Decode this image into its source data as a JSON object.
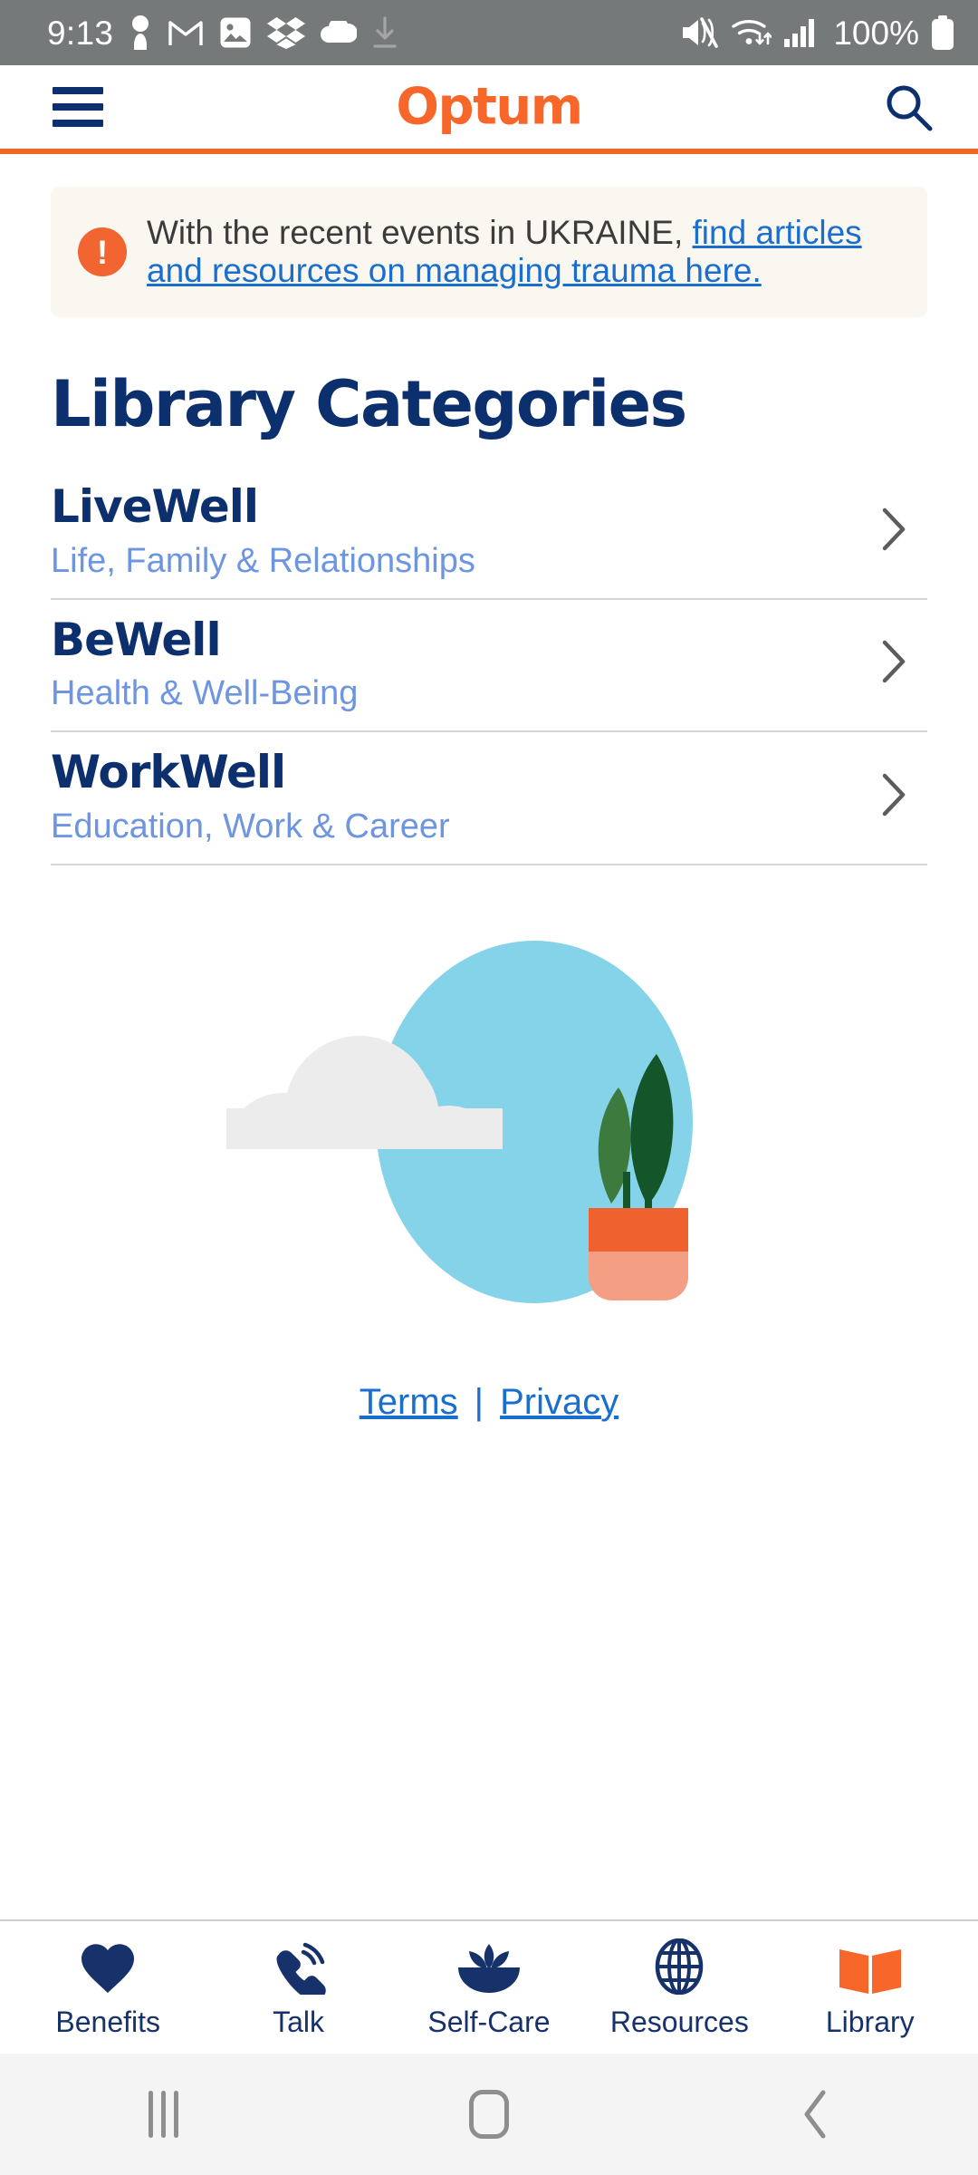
{
  "statusbar": {
    "time": "9:13",
    "battery_percent": "100%",
    "left_icons": [
      "person-keyhole-icon",
      "gmail-icon",
      "photos-image-icon",
      "dropbox-icon",
      "cloud-icon",
      "download-icon"
    ],
    "right_icons": [
      "mute-volume-icon",
      "wifi-icon",
      "cellular-signal-icon",
      "battery-icon"
    ]
  },
  "header": {
    "menu_icon": "hamburger-menu-icon",
    "brand": "Optum",
    "search_icon": "search-icon",
    "accent_color": "#ef6723",
    "navy_color": "#0c2f6d"
  },
  "alert": {
    "icon": "alert-exclamation-icon",
    "text": "With the recent events in UKRAINE,",
    "link_text": "find articles and resources on managing trauma here.",
    "background": "#faf7f0",
    "icon_color": "#f26531",
    "link_color": "#196ecf"
  },
  "main": {
    "title": "Library Categories",
    "categories": [
      {
        "name": "LiveWell",
        "subtitle": "Life, Family & Relationships",
        "chevron": "chevron-right-icon"
      },
      {
        "name": "BeWell",
        "subtitle": "Health & Well-Being",
        "chevron": "chevron-right-icon"
      },
      {
        "name": "WorkWell",
        "subtitle": "Education, Work & Career",
        "chevron": "chevron-right-icon"
      }
    ],
    "illustration": {
      "name": "cloud-plant-illustration",
      "circle_color": "#85d3e8",
      "cloud_color": "#ececec",
      "leaf_light_color": "#3d7a3d",
      "leaf_dark_color": "#14562a",
      "pot_top_color": "#ef6230",
      "pot_bottom_color": "#f49e84"
    }
  },
  "footer": {
    "terms": "Terms",
    "separator": "|",
    "privacy": "Privacy"
  },
  "tabbar": {
    "active": "Library",
    "items": [
      {
        "label": "Benefits",
        "icon": "heart-icon",
        "active": false
      },
      {
        "label": "Talk",
        "icon": "phone-call-icon",
        "active": false
      },
      {
        "label": "Self-Care",
        "icon": "lotus-flower-icon",
        "active": false
      },
      {
        "label": "Resources",
        "icon": "globe-icon",
        "active": false
      },
      {
        "label": "Library",
        "icon": "open-book-icon",
        "active": true
      }
    ],
    "inactive_color": "#17326b",
    "active_color": "#f8672a"
  },
  "sysnav": {
    "recents_icon": "recents-icon",
    "home_icon": "home-icon",
    "back_icon": "back-icon"
  }
}
